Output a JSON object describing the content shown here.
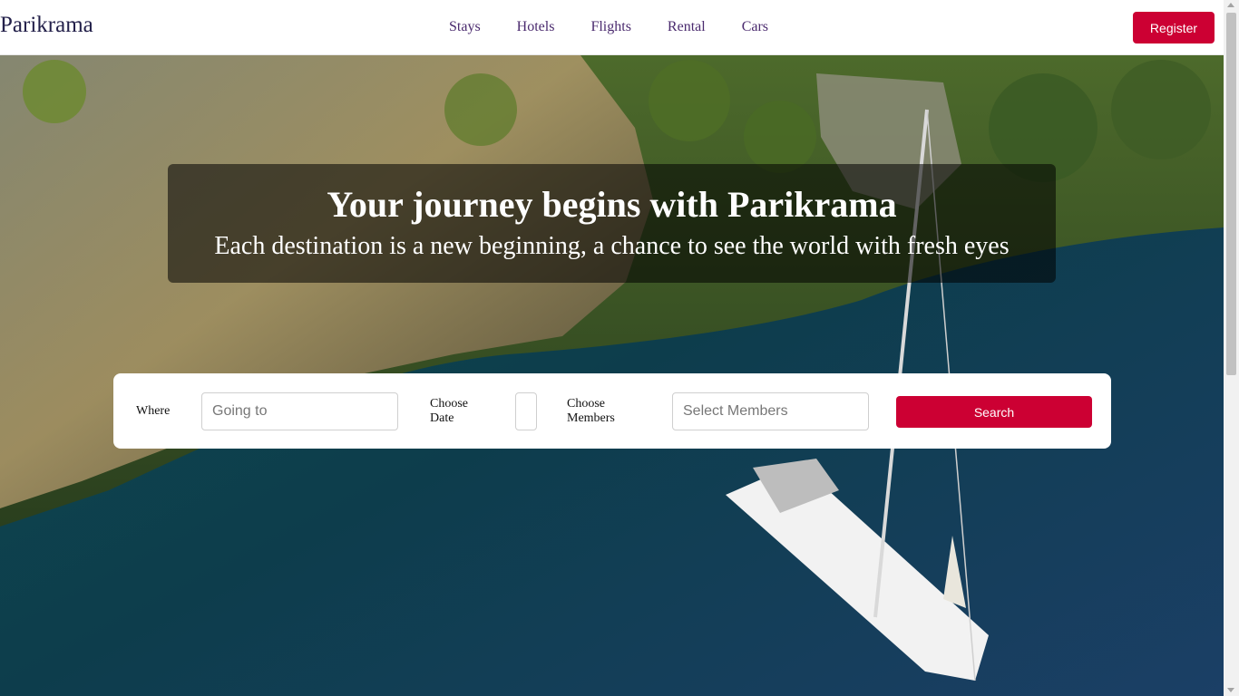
{
  "brand": "Parikrama",
  "nav": [
    "Stays",
    "Hotels",
    "Flights",
    "Rental",
    "Cars"
  ],
  "register_label": "Register",
  "hero": {
    "headline": "Your journey begins with Parikrama",
    "subheadline": "Each destination is a new beginning, a chance to see the world with fresh eyes"
  },
  "search": {
    "where_label": "Where",
    "where_placeholder": "Going to",
    "date_label_line1": "Choose",
    "date_label_line2": "Date",
    "members_label_line1": "Choose",
    "members_label_line2": "Members",
    "members_placeholder": "Select Members",
    "button_label": "Search"
  },
  "colors": {
    "accent": "#cc0033",
    "nav_text": "#4a2a6e",
    "brand_text": "#23204a"
  },
  "icons": [
    "scroll-up-arrow-icon",
    "scroll-down-arrow-icon"
  ]
}
